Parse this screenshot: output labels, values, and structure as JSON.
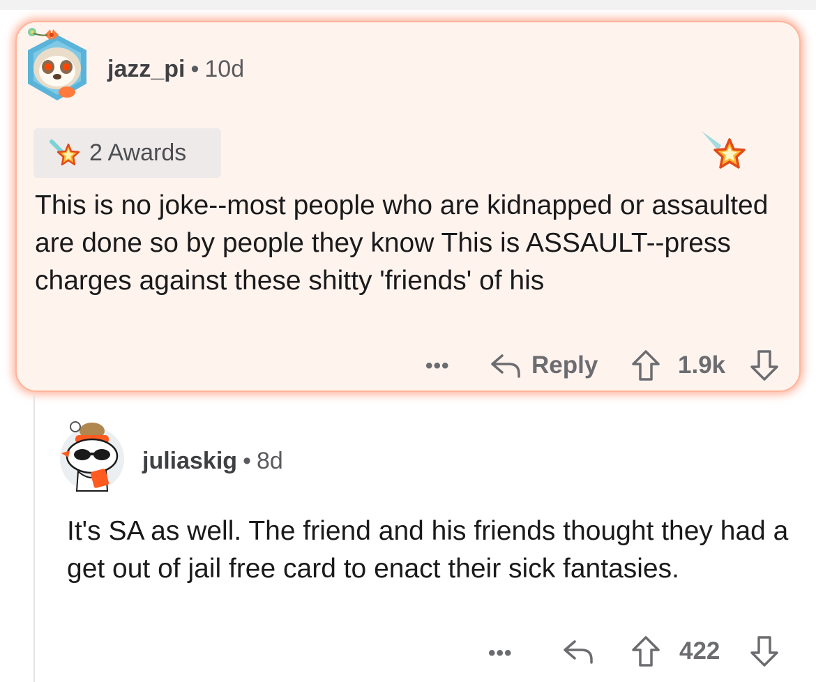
{
  "comments": [
    {
      "username": "jazz_pi",
      "separator": "•",
      "age": "10d",
      "awards_label": "2 Awards",
      "body": "This is no joke--most people who are kidnapped or assaulted are done so by people they know This is ASSAULT--press charges against these shitty 'friends' of his",
      "more": "•••",
      "reply_label": "Reply",
      "score": "1.9k",
      "highlighted": true,
      "colors": {
        "highlight_bg": "#fff3ee",
        "highlight_glow": "#ff7850"
      }
    },
    {
      "username": "juliaskig",
      "separator": "•",
      "age": "8d",
      "body": "It's SA as well.  The friend and his friends thought they had a get out of jail free card to enact their sick fantasies.",
      "more": "•••",
      "score": "422",
      "highlighted": false
    }
  ],
  "icons": {
    "avatar_1": "sloth-avatar-icon",
    "avatar_2": "snoo-sunglasses-avatar-icon",
    "award": "shooting-star-award-icon",
    "reply": "reply-arrow-icon",
    "upvote": "upvote-arrow-icon",
    "downvote": "downvote-arrow-icon"
  }
}
